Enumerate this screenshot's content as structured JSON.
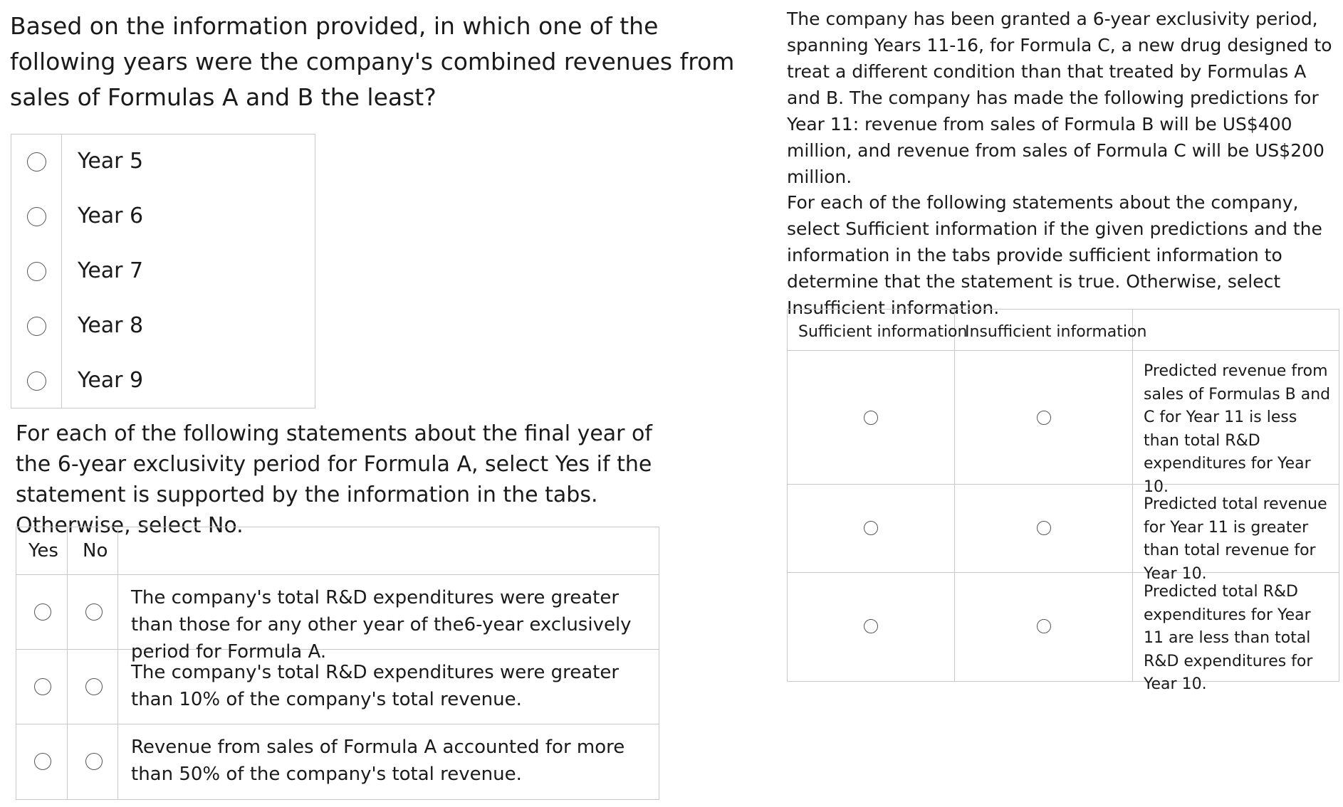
{
  "question1": "Based on the information provided, in which one of the following years were the company's combined revenues from sales of Formulas A and B the least?",
  "options": [
    "Year 5",
    "Year 6",
    "Year 7",
    "Year 8",
    "Year 9"
  ],
  "question2": "For each of the following statements about the final year of the 6-year exclusivity period for Formula A, select Yes if the statement is supported by the information in the tabs. Otherwise, select No.",
  "yn_table": {
    "headers": {
      "yes": "Yes",
      "no": "No"
    },
    "rows": [
      "The company's total R&D expenditures were greater than those for any other year of the6-year exclusively period for Formula A.",
      "The company's total R&D expenditures were greater than 10% of the company's total revenue.",
      "Revenue from sales of Formula A accounted for more than 50% of the company's total revenue."
    ]
  },
  "info_paragraph": "The company has been granted a 6-year exclusivity period, spanning Years 11-16, for Formula C, a new drug designed to treat a different condition than that treated by Formulas A and B. The company has made the following predictions for Year 11: revenue from sales of Formula B will be US$400 million, and revenue from sales of Formula C will be US$200 million.",
  "question3": "For each of the following statements about the company, select Sufficient information if the given predictions and the information in the tabs provide sufficient information to determine that the statement is true. Otherwise, select Insufficient information.",
  "si_table": {
    "headers": {
      "sufficient": "Sufficient information",
      "insufficient": "Insufficient information"
    },
    "rows": [
      "Predicted revenue from sales of Formulas B and C for Year 11 is less than total R&D expenditures for Year 10.",
      "Predicted total revenue for Year 11 is greater than total revenue for Year 10.",
      "Predicted total R&D expenditures for Year 11 are less than total R&D expenditures for Year 10."
    ]
  }
}
